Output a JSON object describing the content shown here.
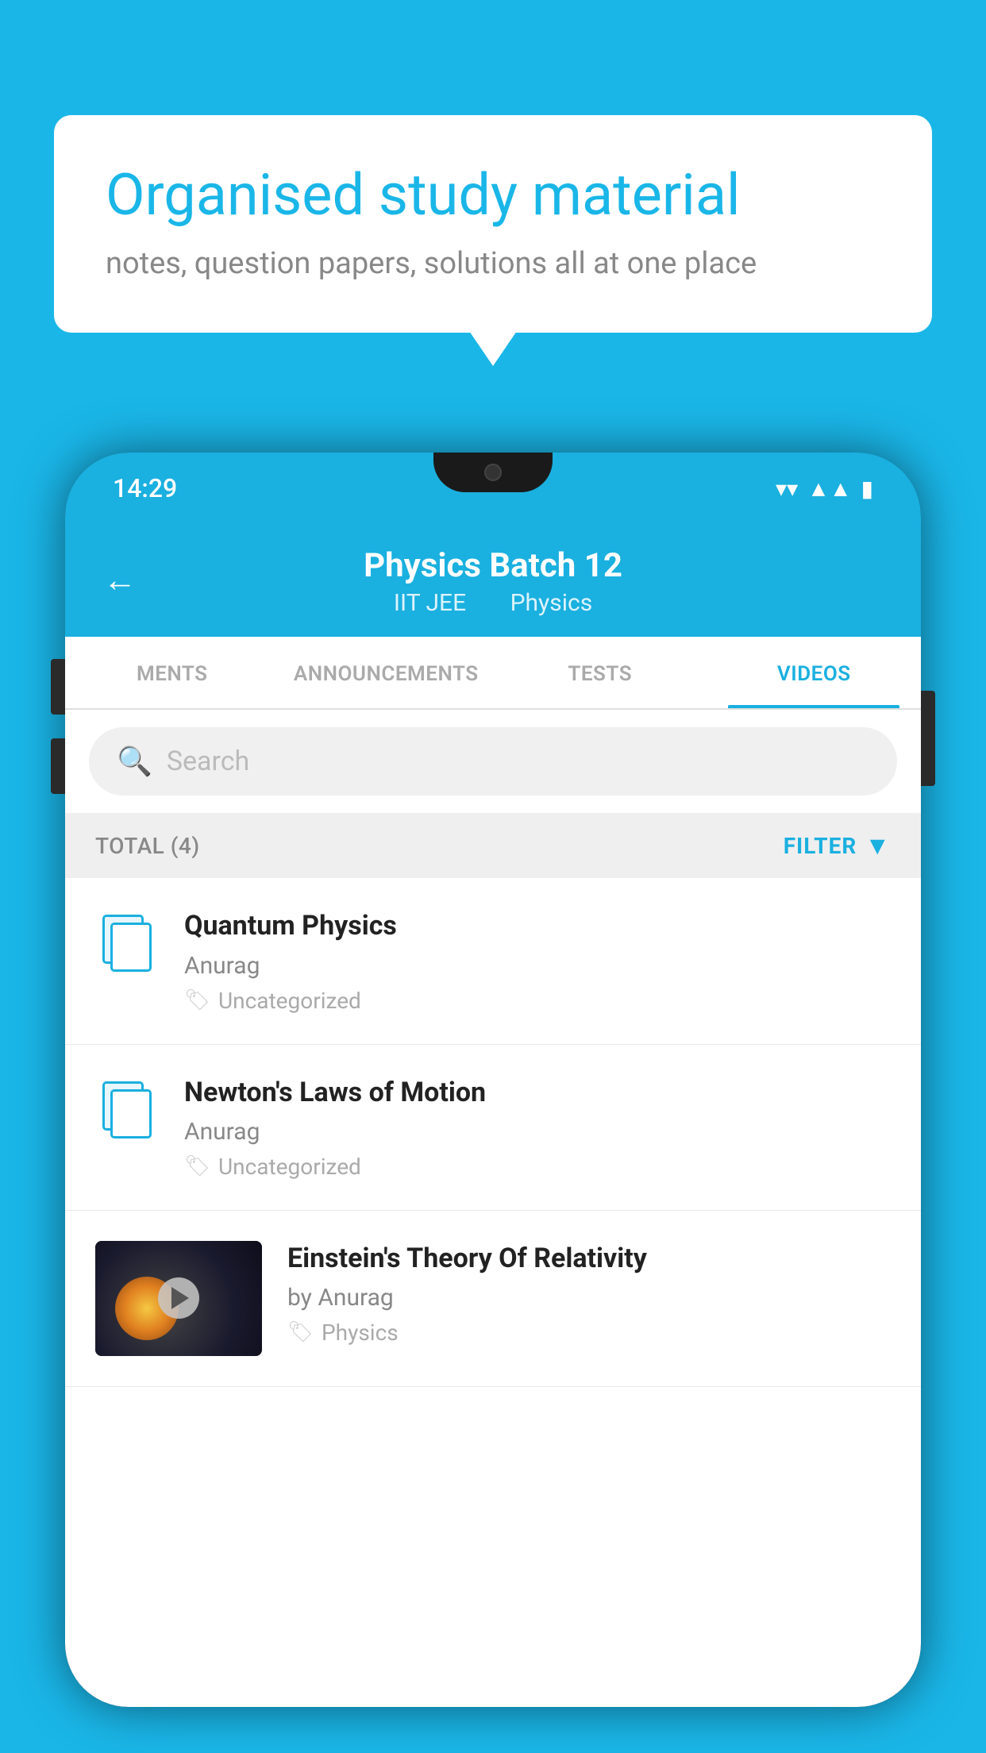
{
  "background_color": "#1ab6e8",
  "speech_bubble": {
    "title": "Organised study material",
    "subtitle": "notes, question papers, solutions all at one place"
  },
  "phone": {
    "status_bar": {
      "time": "14:29",
      "wifi": "▼",
      "signal": "▲",
      "battery": "▮"
    },
    "header": {
      "back_label": "←",
      "title": "Physics Batch 12",
      "subtitle_part1": "IIT JEE",
      "subtitle_part2": "Physics"
    },
    "tabs": [
      {
        "label": "MENTS",
        "active": false
      },
      {
        "label": "ANNOUNCEMENTS",
        "active": false
      },
      {
        "label": "TESTS",
        "active": false
      },
      {
        "label": "VIDEOS",
        "active": true
      }
    ],
    "search": {
      "placeholder": "Search"
    },
    "filter_row": {
      "total_label": "TOTAL (4)",
      "filter_label": "FILTER"
    },
    "videos": [
      {
        "id": 1,
        "title": "Quantum Physics",
        "author": "Anurag",
        "tag": "Uncategorized",
        "has_thumbnail": false
      },
      {
        "id": 2,
        "title": "Newton's Laws of Motion",
        "author": "Anurag",
        "tag": "Uncategorized",
        "has_thumbnail": false
      },
      {
        "id": 3,
        "title": "Einstein's Theory Of Relativity",
        "author": "by Anurag",
        "tag": "Physics",
        "has_thumbnail": true
      }
    ]
  }
}
